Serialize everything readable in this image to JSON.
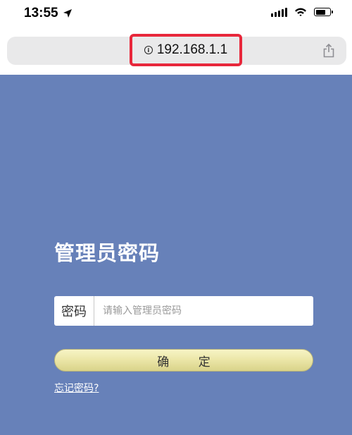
{
  "status_bar": {
    "time": "13:55",
    "icons": [
      "location-arrow-icon",
      "cellular-signal-icon",
      "wifi-icon",
      "battery-icon"
    ],
    "battery_level": 0.75
  },
  "address_bar": {
    "url": "192.168.1.1",
    "icons": [
      "info-icon",
      "share-icon"
    ],
    "highlight_color": "#e8273b"
  },
  "login": {
    "title": "管理员密码",
    "password_label": "密码",
    "password_placeholder": "请输入管理员密码",
    "password_value": "",
    "confirm_label": "确 定",
    "forgot_link": "忘记密码?"
  },
  "colors": {
    "panel_background": "#6781b9",
    "button_background": "#ece7a9"
  }
}
